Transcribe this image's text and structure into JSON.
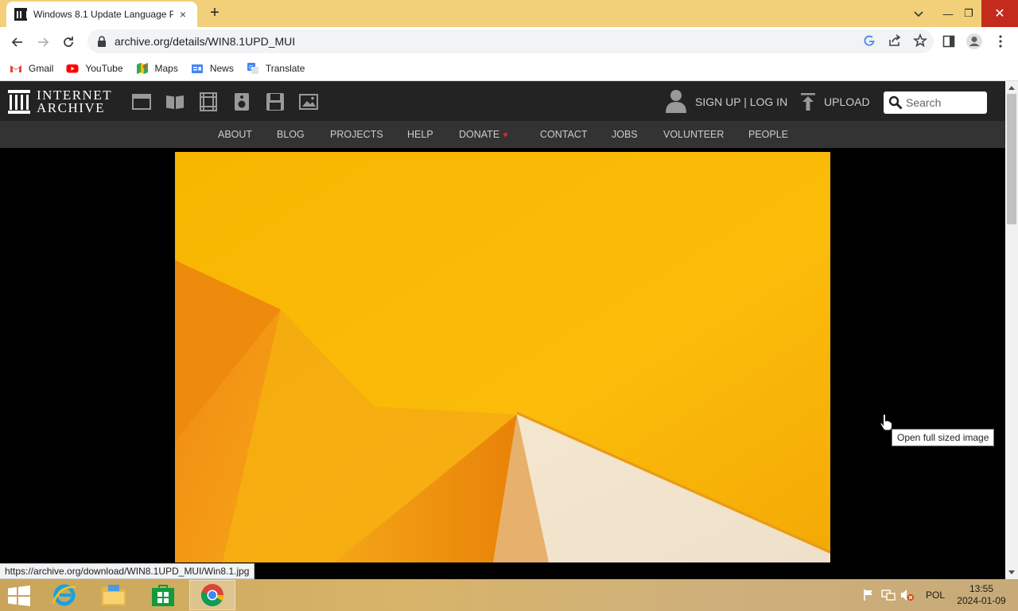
{
  "browser": {
    "tab_title": "Windows 8.1 Update Language P",
    "tab_close": "×",
    "new_tab": "+",
    "window_controls": {
      "minimize": "—",
      "maximize": "❐",
      "close": "✕"
    },
    "url": "archive.org/details/WIN8.1UPD_MUI",
    "bookmarks": [
      {
        "label": "Gmail",
        "icon": "gmail-icon"
      },
      {
        "label": "YouTube",
        "icon": "youtube-icon"
      },
      {
        "label": "Maps",
        "icon": "maps-icon"
      },
      {
        "label": "News",
        "icon": "news-icon"
      },
      {
        "label": "Translate",
        "icon": "translate-icon"
      }
    ],
    "status_url": "https://archive.org/download/WIN8.1UPD_MUI/Win8.1.jpg"
  },
  "archive": {
    "logo_line1": "INTERNET",
    "logo_line2": "ARCHIVE",
    "media_icons": [
      "web-icon",
      "texts-icon",
      "video-icon",
      "audio-icon",
      "software-icon",
      "images-icon"
    ],
    "sign_in": "SIGN UP | LOG IN",
    "upload": "UPLOAD",
    "search_placeholder": "Search",
    "nav": [
      {
        "label": "ABOUT"
      },
      {
        "label": "BLOG"
      },
      {
        "label": "PROJECTS"
      },
      {
        "label": "HELP"
      },
      {
        "label": "DONATE"
      },
      {
        "label": "CONTACT"
      },
      {
        "label": "JOBS"
      },
      {
        "label": "VOLUNTEER"
      },
      {
        "label": "PEOPLE"
      }
    ],
    "tooltip": "Open full sized image"
  },
  "taskbar": {
    "apps": [
      "internet-explorer-icon",
      "file-explorer-icon",
      "store-icon",
      "chrome-icon"
    ],
    "language": "POL",
    "time": "13:55",
    "date": "2024-01-09"
  },
  "colors": {
    "tabstrip": "#f2d079",
    "archive_header": "#232323",
    "archive_nav": "#333333",
    "donate_heart": "#e8212a",
    "hero_yellow": "#f7b200",
    "hero_orange": "#ef8a08"
  }
}
